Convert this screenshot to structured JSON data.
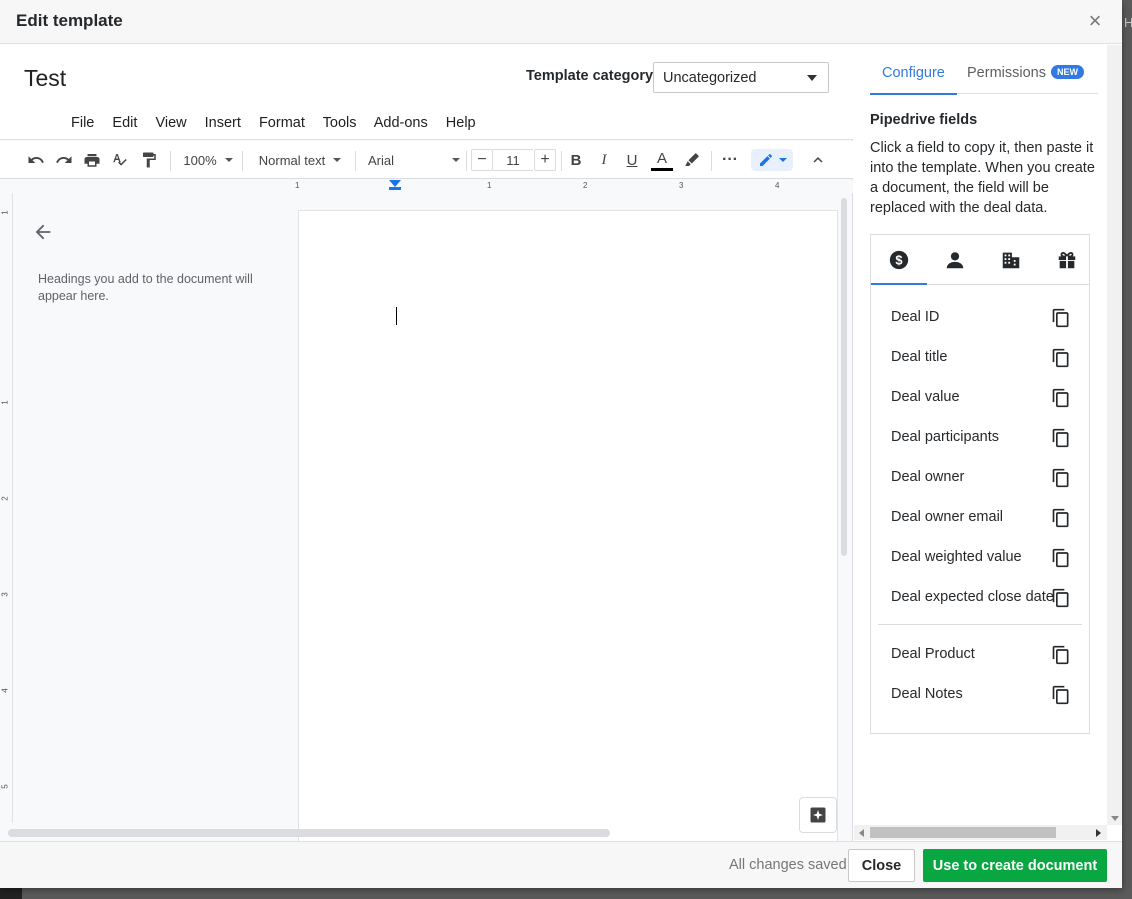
{
  "modal": {
    "title": "Edit template",
    "close_icon": "close-icon"
  },
  "doc": {
    "title": "Test",
    "category_label": "Template category",
    "category_value": "Uncategorized",
    "menu": [
      "File",
      "Edit",
      "View",
      "Insert",
      "Format",
      "Tools",
      "Add-ons",
      "Help"
    ],
    "toolbar": {
      "zoom": "100%",
      "style": "Normal text",
      "font": "Arial",
      "font_size": "11"
    },
    "ruler_h": [
      "1",
      "1",
      "2",
      "3",
      "4"
    ],
    "ruler_v": [
      "1",
      "1",
      "2",
      "3",
      "4",
      "5"
    ],
    "outline_hint": "Headings you add to the document will appear here."
  },
  "panel": {
    "tabs": {
      "configure": "Configure",
      "permissions": "Permissions",
      "badge": "NEW"
    },
    "heading": "Pipedrive fields",
    "description": "Click a field to copy it, then paste it into the template. When you create a document, the field will be replaced with the deal data.",
    "field_tabs": [
      "dollar-icon",
      "person-icon",
      "building-icon",
      "product-icon"
    ],
    "fields": [
      "Deal ID",
      "Deal title",
      "Deal value",
      "Deal participants",
      "Deal owner",
      "Deal owner email",
      "Deal weighted value",
      "Deal expected close date"
    ],
    "fields_extra": [
      "Deal Product",
      "Deal Notes"
    ]
  },
  "footer": {
    "status": "All changes saved",
    "close": "Close",
    "primary": "Use to create document"
  },
  "colors": {
    "accent": "#317ae2",
    "primary_button": "#08a742"
  }
}
